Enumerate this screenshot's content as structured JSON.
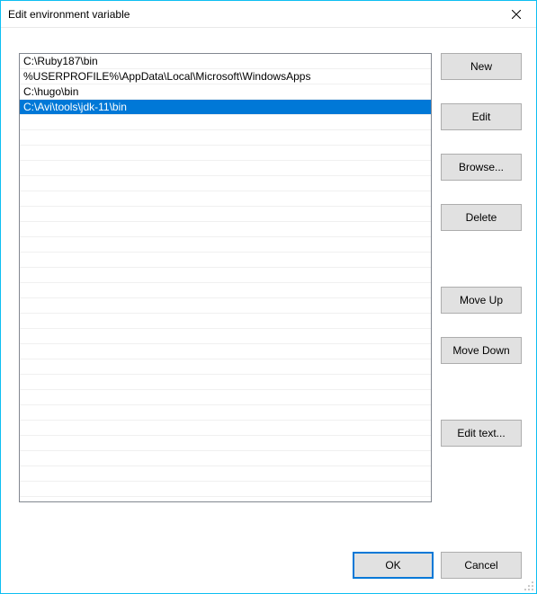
{
  "window": {
    "title": "Edit environment variable"
  },
  "list": {
    "items": [
      {
        "value": "C:\\Ruby187\\bin",
        "selected": false
      },
      {
        "value": "%USERPROFILE%\\AppData\\Local\\Microsoft\\WindowsApps",
        "selected": false
      },
      {
        "value": "C:\\hugo\\bin",
        "selected": false
      },
      {
        "value": "C:\\Avi\\tools\\jdk-11\\bin",
        "selected": true
      }
    ]
  },
  "buttons": {
    "new": "New",
    "edit": "Edit",
    "browse": "Browse...",
    "delete": "Delete",
    "moveUp": "Move Up",
    "moveDown": "Move Down",
    "editText": "Edit text...",
    "ok": "OK",
    "cancel": "Cancel"
  }
}
